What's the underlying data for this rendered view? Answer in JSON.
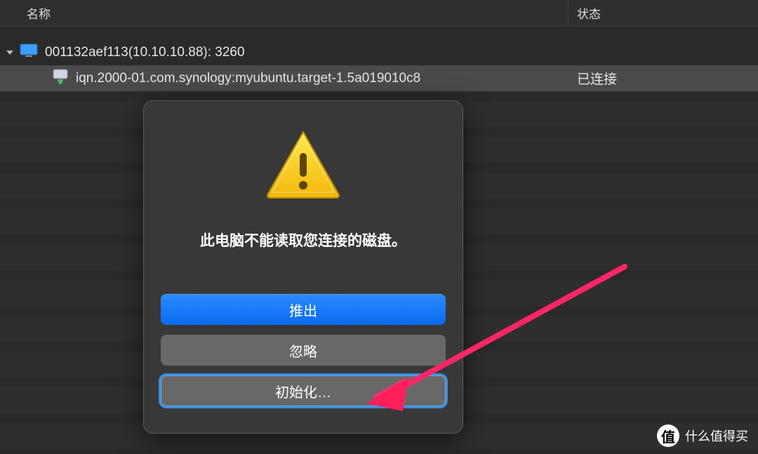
{
  "header": {
    "name_col": "名称",
    "status_col": "状态"
  },
  "rows": {
    "parent": {
      "label": "001132aef113(10.10.10.88): 3260"
    },
    "child": {
      "label": "iqn.2000-01.com.synology:myubuntu.target-1.5a019010c8",
      "status": "已连接"
    }
  },
  "dialog": {
    "message": "此电脑不能读取您连接的磁盘。",
    "eject": "推出",
    "ignore": "忽略",
    "initialize": "初始化…"
  },
  "watermark": {
    "badge": "值",
    "text": "什么值得买"
  }
}
